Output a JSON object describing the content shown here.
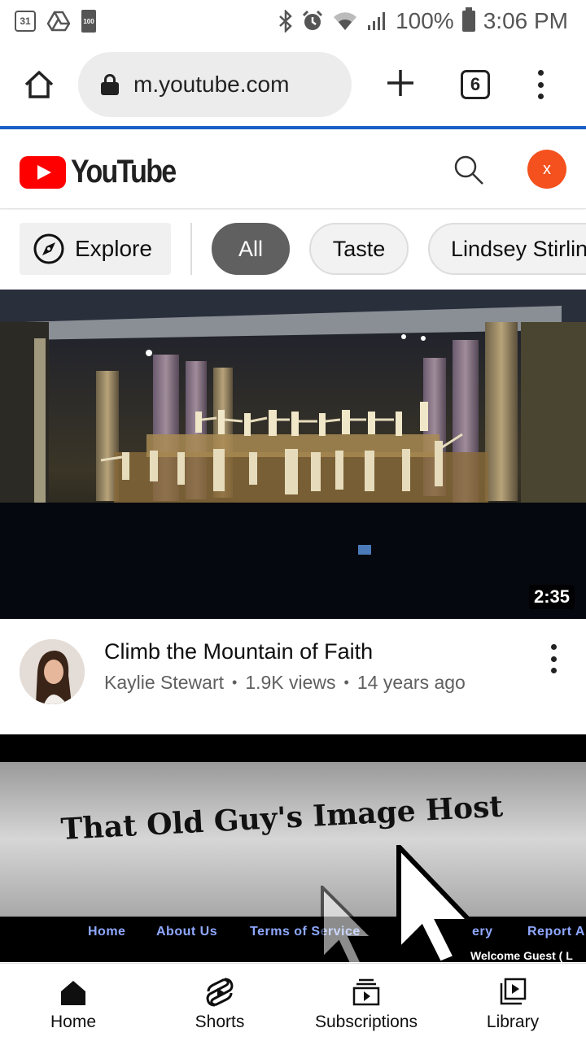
{
  "status_bar": {
    "calendar_date": "31",
    "battery_small_label": "100",
    "battery_percent": "100%",
    "time": "3:06 PM",
    "icons": [
      "calendar-icon",
      "drive-icon",
      "battery-saver-icon",
      "bluetooth-icon",
      "alarm-icon",
      "wifi-icon",
      "signal-icon",
      "battery-icon"
    ]
  },
  "browser": {
    "url": "m.youtube.com",
    "tab_count": "6",
    "icons": [
      "home-icon",
      "lock-icon",
      "new-tab-icon",
      "tabs-icon",
      "overflow-menu-icon"
    ]
  },
  "youtube_header": {
    "logo_text": "YouTube",
    "avatar_letter": "x",
    "colors": {
      "logo_red": "#ff0000",
      "avatar_bg": "#f4511e"
    }
  },
  "chips": {
    "explore_label": "Explore",
    "items": [
      {
        "label": "All",
        "active": true
      },
      {
        "label": "Taste",
        "active": false
      },
      {
        "label": "Lindsey Stirlin",
        "active": false
      }
    ]
  },
  "videos": [
    {
      "title": "Climb the Mountain of Faith",
      "channel": "Kaylie Stewart",
      "views": "1.9K views",
      "age": "14 years ago",
      "separator": "•",
      "duration": "2:35"
    },
    {
      "thumbnail_text": {
        "site_title": "That Old Guy's Image Host",
        "nav_links": [
          "Home",
          "About Us",
          "Terms of Service",
          "ery",
          "Report A"
        ],
        "welcome": "Welcome Guest ( L"
      }
    }
  ],
  "bottom_nav": {
    "items": [
      {
        "label": "Home",
        "icon": "home-filled-icon"
      },
      {
        "label": "Shorts",
        "icon": "shorts-icon"
      },
      {
        "label": "Subscriptions",
        "icon": "subscriptions-icon"
      },
      {
        "label": "Library",
        "icon": "library-icon"
      }
    ]
  }
}
